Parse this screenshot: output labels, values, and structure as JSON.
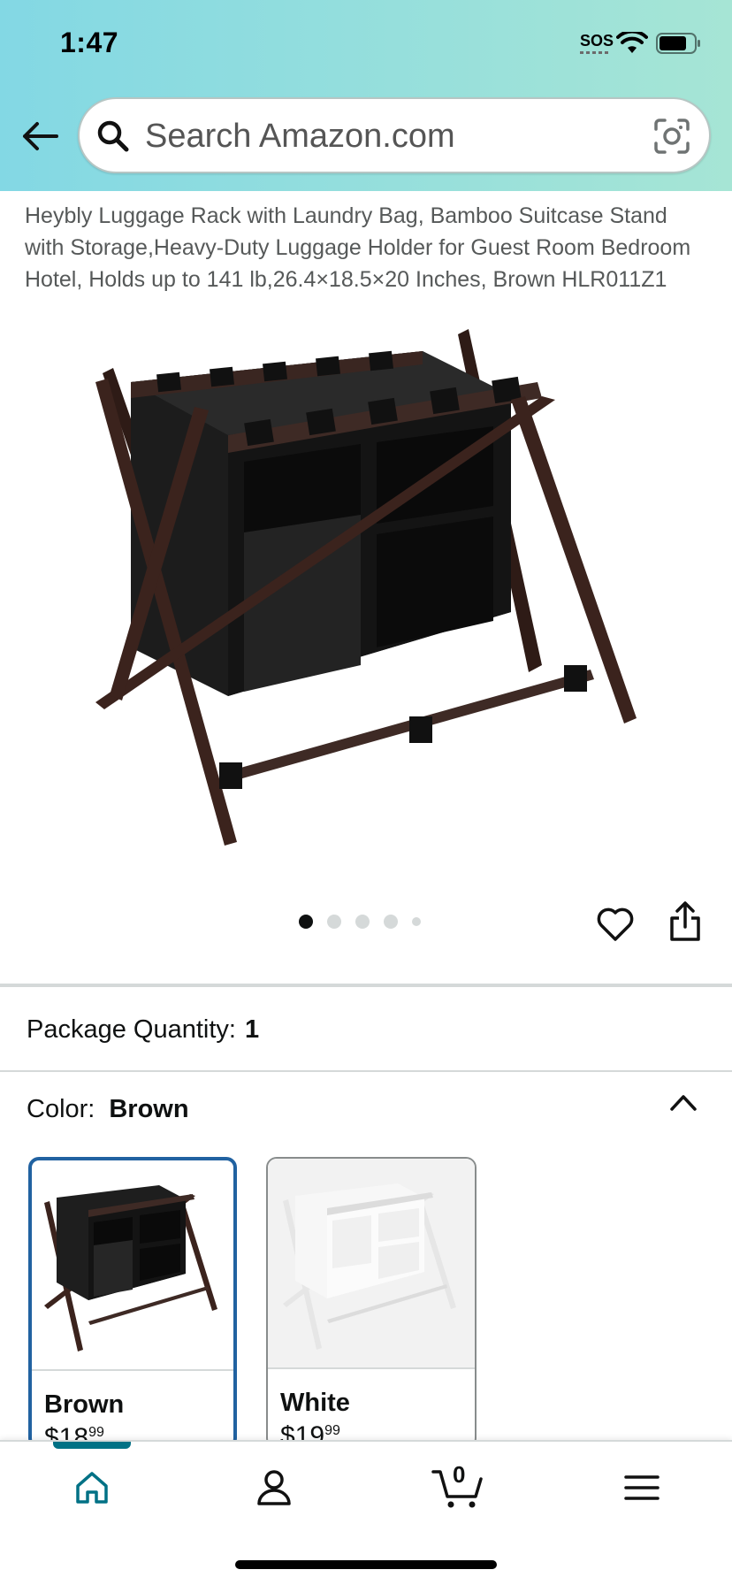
{
  "status_bar": {
    "time": "1:47",
    "sos": "SOS"
  },
  "search": {
    "placeholder": "Search Amazon.com"
  },
  "product": {
    "title": "Heybly Luggage Rack with Laundry Bag, Bamboo Suitcase Stand with Storage,Heavy-Duty Luggage Holder for Guest Room Bedroom Hotel, Holds up to 141 lb,26.4×18.5×20 Inches, Brown HLR011Z1",
    "image_count": 5,
    "active_image_index": 0
  },
  "package": {
    "label": "Package Quantity:",
    "value": "1"
  },
  "color": {
    "label": "Color:",
    "selected": "Brown",
    "options": [
      {
        "name": "Brown",
        "price_dollars": "$18",
        "price_cents": "99"
      },
      {
        "name": "White",
        "price_dollars": "$19",
        "price_cents": "99"
      }
    ]
  },
  "cart": {
    "count": "0"
  },
  "colors": {
    "header_left": "#83d8e4",
    "header_right": "#a6e5d5",
    "selected_border": "#2162a1",
    "active_tab": "#007185"
  },
  "icons": {
    "back": "back-arrow-icon",
    "search": "search-icon",
    "camera": "camera-lens-icon",
    "heart": "heart-icon",
    "share": "share-icon",
    "collapse": "chevron-up-icon",
    "home": "home-icon",
    "account": "account-icon",
    "cart": "cart-icon",
    "menu": "menu-icon"
  }
}
